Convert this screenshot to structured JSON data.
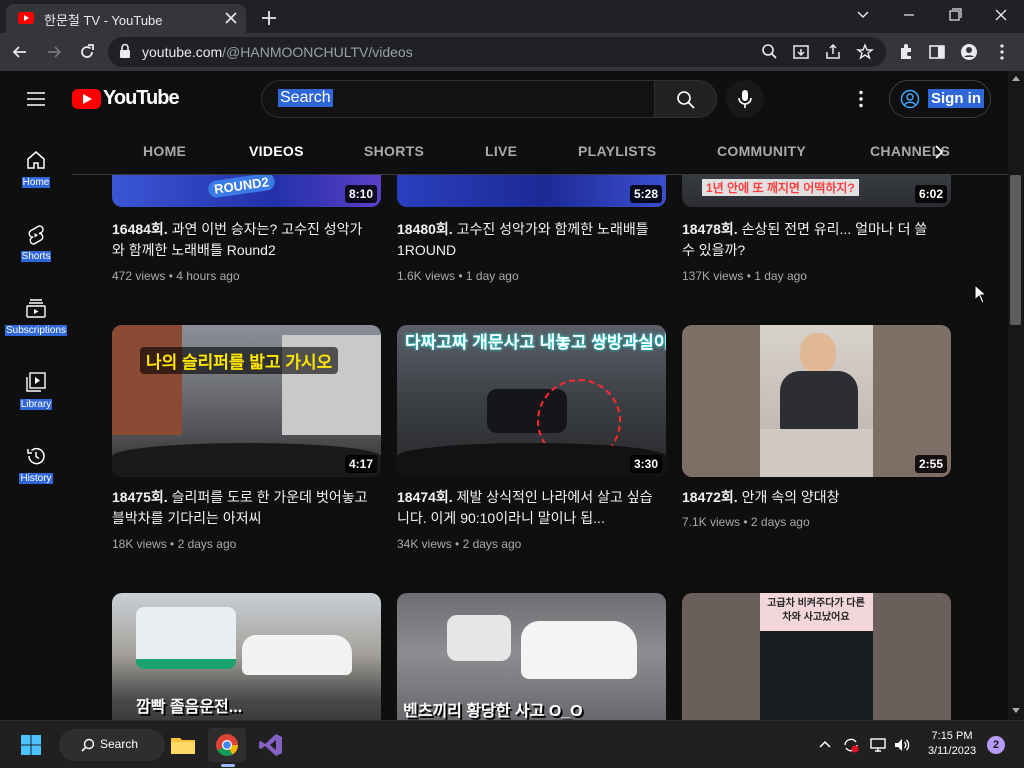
{
  "browser": {
    "tab_title": "한문철 TV - YouTube",
    "url_host": "youtube.com",
    "url_path": "/@HANMOONCHULTV/videos"
  },
  "youtube": {
    "logo_text": "YouTube",
    "search_placeholder": "Search",
    "signin_label": "Sign in",
    "rail": [
      {
        "label": "Home",
        "icon": "home-icon"
      },
      {
        "label": "Shorts",
        "icon": "shorts-icon"
      },
      {
        "label": "Subscriptions",
        "icon": "subscriptions-icon"
      },
      {
        "label": "Library",
        "icon": "library-icon"
      },
      {
        "label": "History",
        "icon": "history-icon"
      }
    ],
    "channel_tabs": [
      "HOME",
      "VIDEOS",
      "SHORTS",
      "LIVE",
      "PLAYLISTS",
      "COMMUNITY",
      "CHANNELS"
    ],
    "active_tab": "VIDEOS",
    "videos": [
      {
        "title_bold": "16484회.",
        "title_rest": " 과연 이번 승자는? 고수진 성악가와 함께한 노래배틀 Round2",
        "views": "472 views",
        "age": "4 hours ago",
        "duration": "8:10",
        "overlay": "ROUND2"
      },
      {
        "title_bold": "18480회.",
        "title_rest": " 고수진 성악가와 함께한 노래배틀 1ROUND",
        "views": "1.6K views",
        "age": "1 day ago",
        "duration": "5:28",
        "overlay": ""
      },
      {
        "title_bold": "18478회.",
        "title_rest": " 손상된 전면 유리... 얼마나 더 쓸 수 있을까?",
        "views": "137K views",
        "age": "1 day ago",
        "duration": "6:02",
        "overlay": "1년 안에 또 깨지면 어떡하지?"
      },
      {
        "title_bold": "18475회.",
        "title_rest": " 슬리퍼를 도로 한 가운데 벗어놓고 블박차를 기다리는 아저씨",
        "views": "18K views",
        "age": "2 days ago",
        "duration": "4:17",
        "overlay": "나의 슬리퍼를 밟고 가시오"
      },
      {
        "title_bold": "18474회.",
        "title_rest": " 제발 상식적인 나라에서 살고 싶습니다. 이게 90:10이라니 말이나 됩...",
        "views": "34K views",
        "age": "2 days ago",
        "duration": "3:30",
        "overlay": "다짜고짜 개문사고 내놓고 쌍방과실이라니요?"
      },
      {
        "title_bold": "18472회.",
        "title_rest": " 안개 속의 양대창",
        "views": "7.1K views",
        "age": "2 days ago",
        "duration": "2:55",
        "overlay": ""
      },
      {
        "title_bold": "",
        "title_rest": "",
        "views": "",
        "age": "",
        "duration": "",
        "overlay": "깜빡 졸음운전..."
      },
      {
        "title_bold": "",
        "title_rest": "",
        "views": "",
        "age": "",
        "duration": "",
        "overlay": "벤츠끼리 황당한 사고 O_O"
      },
      {
        "title_bold": "",
        "title_rest": "",
        "views": "",
        "age": "",
        "duration": "",
        "overlay": "고급차 비켜주다가 다른 차와 사고났어요"
      }
    ]
  },
  "taskbar": {
    "search_label": "Search",
    "time": "7:15 PM",
    "date": "3/11/2023",
    "notifications": "2"
  },
  "colors": {
    "youtube_red": "#ff0000",
    "background": "#0f0f0f",
    "selection_blue": "#2f66d8"
  }
}
